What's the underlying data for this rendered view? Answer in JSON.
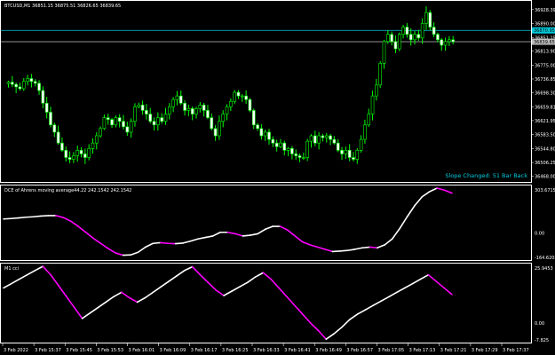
{
  "window": {
    "symbol_header": "BTCUSD,M1  36851.15 36875.51 36826.65 36839.65"
  },
  "colors": {
    "background": "#000000",
    "foreground": "#ffffff",
    "bull_body": "#000000",
    "bull_outline": "#00ff00",
    "bear_body": "#ffffff",
    "bear_outline": "#00ff00",
    "price_line": "#c0c0c0",
    "highlight_price_line": "#00ccdd",
    "rising": "#ffffff",
    "falling": "#ff00ff",
    "annotation": "#00ccdd"
  },
  "price_panel": {
    "annotation": "Slope Changed: 51 Bar Back",
    "axis_labels": [
      "36928.39",
      "36890.00",
      "36851.15",
      "36813.90",
      "36775.00",
      "36736.85",
      "36698.30",
      "36659.81",
      "36621.95",
      "36583.50",
      "36544.80",
      "36506.25",
      "36468.00"
    ],
    "current_price_label": "36839.65",
    "highlight_price_label": "36870.95",
    "lines": [
      {
        "value": 36870.95,
        "color": "#00ccdd"
      },
      {
        "value": 36839.65,
        "color": "#c0c0c0"
      }
    ]
  },
  "dce_panel": {
    "title": "DCE of Ahrens moving average44.22 242.1542 242.1542",
    "axis_labels": [
      "303.6715",
      "0.00",
      "-164.6208"
    ]
  },
  "cci_panel": {
    "title": "M1 cci",
    "axis_labels": [
      "25.9453",
      "0.00",
      "-7.825"
    ]
  },
  "time_axis": {
    "labels": [
      "3 Feb 2022",
      "3 Feb 15:37",
      "3 Feb 15:45",
      "3 Feb 15:53",
      "3 Feb 16:01",
      "3 Feb 16:09",
      "3 Feb 16:17",
      "3 Feb 16:25",
      "3 Feb 16:33",
      "3 Feb 16:41",
      "3 Feb 16:49",
      "3 Feb 16:57",
      "3 Feb 17:05",
      "3 Feb 17:13",
      "3 Feb 17:21",
      "3 Feb 17:29",
      "3 Feb 17:37"
    ]
  },
  "chart_data": [
    {
      "type": "candlestick",
      "title": "BTCUSD,M1",
      "ylim": [
        36460,
        36945
      ],
      "close_series": [
        36728,
        36722,
        36715,
        36710,
        36730,
        36738,
        36730,
        36725,
        36705,
        36670,
        36645,
        36610,
        36590,
        36560,
        36540,
        36520,
        36515,
        36525,
        36540,
        36530,
        36520,
        36545,
        36560,
        36580,
        36600,
        36630,
        36625,
        36610,
        36630,
        36620,
        36605,
        36590,
        36620,
        36660,
        36665,
        36650,
        36640,
        36620,
        36610,
        36630,
        36620,
        36640,
        36660,
        36680,
        36690,
        36670,
        36650,
        36655,
        36640,
        36655,
        36665,
        36650,
        36630,
        36600,
        36580,
        36620,
        36640,
        36660,
        36675,
        36700,
        36690,
        36690,
        36680,
        36650,
        36610,
        36600,
        36580,
        36590,
        36570,
        36560,
        36550,
        36560,
        36540,
        36545,
        36530,
        36525,
        36520,
        36520,
        36565,
        36580,
        36560,
        36580,
        36575,
        36580,
        36570,
        36560,
        36540,
        36530,
        36540,
        36520,
        36515,
        36540,
        36570,
        36610,
        36640,
        36690,
        36720,
        36780,
        36840,
        36860,
        36840,
        36820,
        36860,
        36880,
        36860,
        36845,
        36860,
        36850,
        36890,
        36920,
        36880,
        36860,
        36845,
        36830,
        36840,
        36845,
        36839.65
      ]
    },
    {
      "type": "line",
      "title": "DCE of Ahrens moving average44.22 242.1542 242.1542",
      "ylim": [
        -164.6208,
        303.6715
      ],
      "series": [
        {
          "values": [
            95,
            98,
            102,
            107,
            110,
            115,
            118,
            118,
            105,
            80,
            45,
            5,
            -35,
            -70,
            -105,
            -135,
            -150,
            -148,
            -130,
            -95,
            -70,
            -65,
            -70,
            -72,
            -68,
            -55,
            -40,
            -30,
            -20,
            5,
            5,
            -5,
            -20,
            -15,
            -5,
            25,
            45,
            45,
            20,
            -20,
            -60,
            -80,
            -95,
            -110,
            -125,
            -122,
            -118,
            -110,
            -100,
            -95,
            -100,
            -80,
            -40,
            30,
            110,
            185,
            245,
            280,
            303.67,
            290,
            270
          ]
        }
      ]
    },
    {
      "type": "line",
      "title": "M1 cci",
      "ylim": [
        -7.825,
        25.9453
      ],
      "series": [
        {
          "values": [
            16,
            18,
            20,
            22,
            24,
            25.9,
            22,
            17,
            12,
            7,
            2,
            4.5,
            7,
            9.5,
            12,
            14,
            11.5,
            9.5,
            11.5,
            14,
            16.5,
            19,
            21.5,
            24,
            25.7,
            22,
            18.5,
            15,
            12.5,
            14.5,
            16.5,
            18.5,
            21,
            23,
            20,
            16,
            12,
            8,
            4,
            0,
            -3.5,
            -7.5,
            -5,
            -2,
            1.5,
            4,
            6,
            8,
            10,
            12,
            14,
            16,
            18,
            20,
            22,
            19,
            16,
            13
          ]
        }
      ]
    }
  ]
}
